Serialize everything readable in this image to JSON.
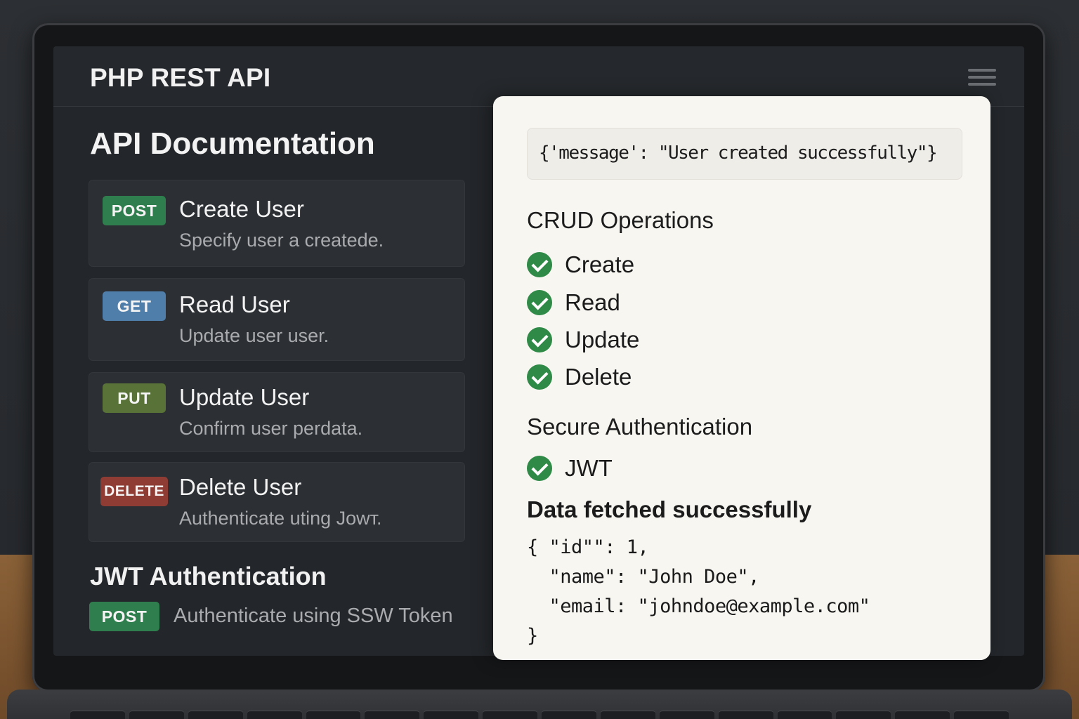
{
  "app": {
    "title": "PHP REST API"
  },
  "docs": {
    "heading": "API Documentation",
    "endpoints": [
      {
        "method": "POST",
        "title": "Create User",
        "description": "Specify user a createde."
      },
      {
        "method": "GET",
        "title": "Read User",
        "description": "Update user user."
      },
      {
        "method": "PUT",
        "title": "Update User",
        "description": "Confirm user perdata."
      },
      {
        "method": "DELETE",
        "title": "Delete User",
        "description": "Authenticate uting Jowт."
      }
    ],
    "jwt": {
      "heading": "JWT Authentication",
      "method": "POST",
      "description": "Authenticate using SSW Token"
    }
  },
  "panel": {
    "response": "{'message': \"User created successfully\"}",
    "crud": {
      "heading": "CRUD Operations",
      "items": [
        "Create",
        "Read",
        "Update",
        "Delete"
      ]
    },
    "auth": {
      "heading": "Secure Authentication",
      "items": [
        "JWT"
      ]
    },
    "data": {
      "heading": "Data fetched successfully",
      "json": "{ \"id\"\": 1,\n  \"name\": \"John Doe\",\n  \"emai̇l: \"johndoe@example.com\"\n}"
    }
  },
  "colors": {
    "post": "#2e7f4d",
    "get": "#4f7eab",
    "put": "#587238",
    "delete": "#8f3c34",
    "check": "#2f8a48"
  },
  "icons": {
    "menu": "hamburger-menu-icon",
    "check": "check-circle-icon"
  }
}
